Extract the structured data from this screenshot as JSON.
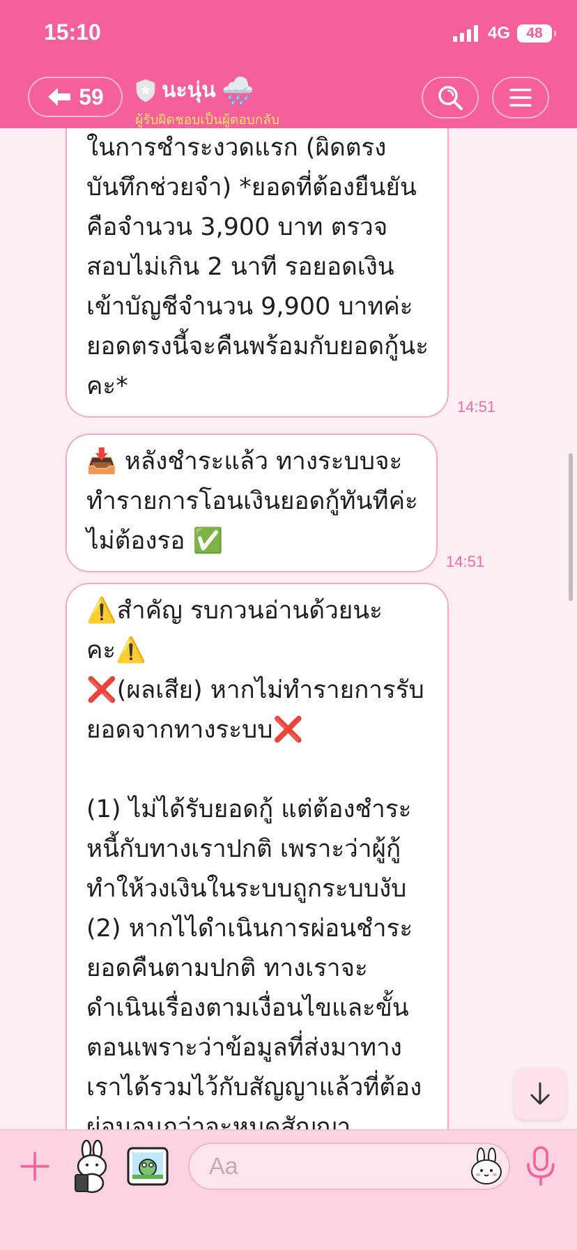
{
  "status_bar": {
    "time": "15:10",
    "network": "4G",
    "battery": "48"
  },
  "header": {
    "back_count": "59",
    "title": "นะนุ่น",
    "title_emoji": "🌧️",
    "subtitle": "ผู้รับผิดชอบเป็นผู้ตอบกลับ",
    "icons": {
      "back": "back-arrow-icon",
      "verified": "shield-icon",
      "search": "search-icon",
      "menu": "menu-icon"
    }
  },
  "messages": [
    {
      "text": "ในการชำระงวดแรก (ผิดตรงบันทึกช่วยจำ) *ยอดที่ต้องยืนยันคือจำนวน 3,900 บาท ตรวจสอบไม่เกิน 2 นาที รอยอดเงินเข้าบัญชีจำนวน 9,900 บาทค่ะ ยอดตรงนี้จะคืนพร้อมกับยอดกู้นะคะ*",
      "time": "14:51"
    },
    {
      "text": "📥 หลังชำระแล้ว ทางระบบจะทำรายการโอนเงินยอดกู้ทันทีค่ะไม่ต้องรอ ✅",
      "time": "14:51"
    },
    {
      "text": "⚠️สำคัญ รบกวนอ่านด้วยนะคะ⚠️\n❌(ผลเสีย) หากไม่ทำรายการรับยอดจากทางระบบ❌\n\n(1) ไม่ได้รับยอดกู้ แต่ต้องชำระหนี้กับทางเราปกติ เพราะว่าผู้กู้ทำให้วงเงินในระบบถูกระบบงับ\n(2) หากไไดำเนินการผ่อนชำระยอดคืนตามปกติ ทางเราจะดำเนินเรื่องตามเงื่อนไขและขั้นตอนเพราะว่าข้อมูลที่ส่งมาทางเราได้รวมไว้กับสัญญาแล้วที่ต้องผ่อนจนกว่าจะหมดสัญญา",
      "time": ""
    }
  ],
  "input_bar": {
    "placeholder": "Aa",
    "icons": {
      "plus": "plus-icon",
      "sticker": "sticker-icon",
      "photo": "photo-icon",
      "emoji": "emoji-icon",
      "mic": "microphone-icon"
    }
  },
  "scroll_down": {
    "icon": "arrow-down-icon"
  },
  "colors": {
    "header_bg": "#f5609a",
    "chat_bg": "#fdeef4",
    "bubble_border": "#f6a9c8",
    "timestamp": "#f56ca3",
    "subtitle": "#ffe766",
    "input_bar_bg": "#fdd3e2"
  }
}
